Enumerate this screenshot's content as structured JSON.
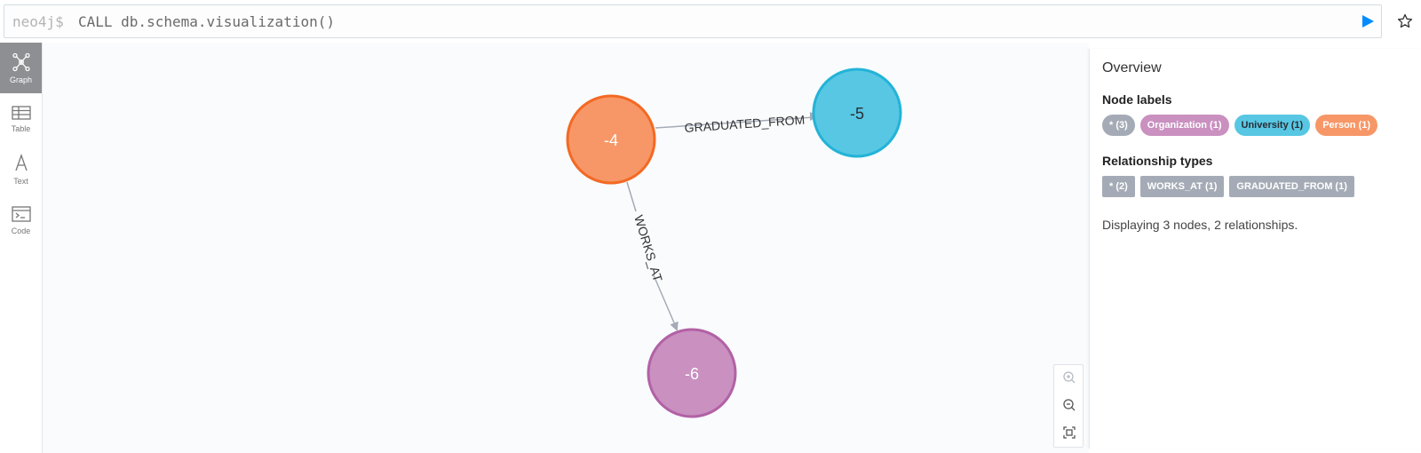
{
  "editor": {
    "prompt": "neo4j$",
    "query": "CALL db.schema.visualization()"
  },
  "sidebar": {
    "items": [
      {
        "label": "Graph",
        "icon": "graph-icon",
        "active": true
      },
      {
        "label": "Table",
        "icon": "table-icon",
        "active": false
      },
      {
        "label": "Text",
        "icon": "text-icon",
        "active": false
      },
      {
        "label": "Code",
        "icon": "code-icon",
        "active": false
      }
    ]
  },
  "graph": {
    "nodes": [
      {
        "id": "n4",
        "label": "-4",
        "fill": "#f79767",
        "stroke": "#f36924"
      },
      {
        "id": "n5",
        "label": "-5",
        "fill": "#57c7e3",
        "stroke": "#23b3d7"
      },
      {
        "id": "n6",
        "label": "-6",
        "fill": "#c990c0",
        "stroke": "#b261a5"
      }
    ],
    "relationships": [
      {
        "type": "GRADUATED_FROM",
        "from": "n4",
        "to": "n5"
      },
      {
        "type": "WORKS_AT",
        "from": "n4",
        "to": "n6"
      }
    ]
  },
  "overview": {
    "title": "Overview",
    "node_labels_title": "Node labels",
    "node_labels": [
      {
        "text": "* (3)",
        "color": "#a5abb6",
        "textColor": "#ffffff"
      },
      {
        "text": "Organization (1)",
        "color": "#c990c0",
        "textColor": "#ffffff"
      },
      {
        "text": "University (1)",
        "color": "#57c7e3",
        "textColor": "#2a2c34"
      },
      {
        "text": "Person (1)",
        "color": "#f79767",
        "textColor": "#ffffff"
      }
    ],
    "rel_types_title": "Relationship types",
    "rel_types": [
      {
        "text": "* (2)",
        "color": "#a5abb6"
      },
      {
        "text": "WORKS_AT (1)",
        "color": "#a5abb6"
      },
      {
        "text": "GRADUATED_FROM (1)",
        "color": "#a5abb6"
      }
    ],
    "status": "Displaying 3 nodes, 2 relationships."
  },
  "colors": {
    "run": "#018bff",
    "edge": "#a5abb6"
  }
}
